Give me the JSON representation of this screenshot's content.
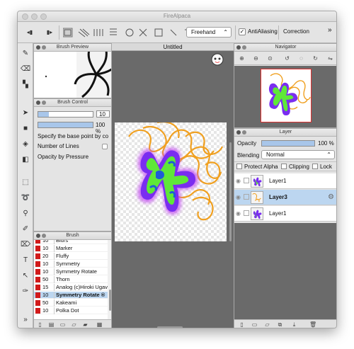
{
  "window": {
    "title": "FireAlpaca"
  },
  "toolbar": {
    "brush_mode": "Freehand",
    "antialiasing_label": "AntiAliasing",
    "antialiasing_checked": "✓",
    "correction_label": "Correction",
    "more": "»"
  },
  "brush_preview": {
    "title": "Brush Preview"
  },
  "brush_control": {
    "title": "Brush Control",
    "size_value": "10",
    "opacity_value": "100 %",
    "specify_text": "Specify the base point by co",
    "lines_label": "Number of Lines",
    "opacity_pressure_label": "Opacity by Pressure"
  },
  "brush": {
    "title": "Brush",
    "items": [
      {
        "size": "10",
        "name": "Blurs"
      },
      {
        "size": "10",
        "name": "Marker"
      },
      {
        "size": "20",
        "name": "Fluffy"
      },
      {
        "size": "10",
        "name": "Symmetry"
      },
      {
        "size": "10",
        "name": "Symmetry Rotate"
      },
      {
        "size": "50",
        "name": "Thorn"
      },
      {
        "size": "15",
        "name": "Analog (c)Hiroki Ugav"
      },
      {
        "size": "10",
        "name": "Symmetry Rotate ®"
      },
      {
        "size": "50",
        "name": "Kakeami"
      },
      {
        "size": "10",
        "name": "Polka Dot"
      }
    ]
  },
  "canvas": {
    "tab_title": "Untitled"
  },
  "navigator": {
    "title": "Navigator"
  },
  "layer": {
    "title": "Layer",
    "opacity_label": "Opacity",
    "opacity_value": "100 %",
    "blending_label": "Blending",
    "blending_value": "Normal",
    "protect_alpha_label": "Protect Alpha",
    "clipping_label": "Clipping",
    "lock_label": "Lock",
    "layers": [
      {
        "name": "Layer1"
      },
      {
        "name": "Layer3"
      },
      {
        "name": "Layer1"
      }
    ]
  },
  "colors": {
    "accent": "#a8c6ea",
    "selection": "#bcd6f0",
    "brush_swatch": "#d11a1a"
  }
}
